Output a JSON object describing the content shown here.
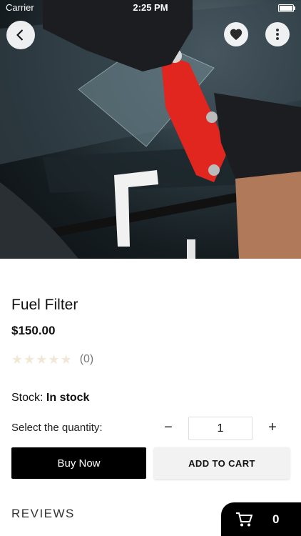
{
  "status_bar": {
    "carrier": "Carrier",
    "time": "2:25 PM"
  },
  "product": {
    "title": "Fuel Filter",
    "price": "$150.00",
    "rating_count": "(0)",
    "stock_label": "Stock:",
    "stock_value": "In stock"
  },
  "quantity": {
    "label": "Select the quantity:",
    "value": "1",
    "minus": "−",
    "plus": "+"
  },
  "actions": {
    "buy_now": "Buy Now",
    "add_to_cart": "ADD TO CART"
  },
  "reviews": {
    "heading": "REVIEWS"
  },
  "cart": {
    "count": "0"
  },
  "icons": [
    "back-icon",
    "heart-icon",
    "more-icon",
    "star-icon",
    "cart-icon"
  ]
}
